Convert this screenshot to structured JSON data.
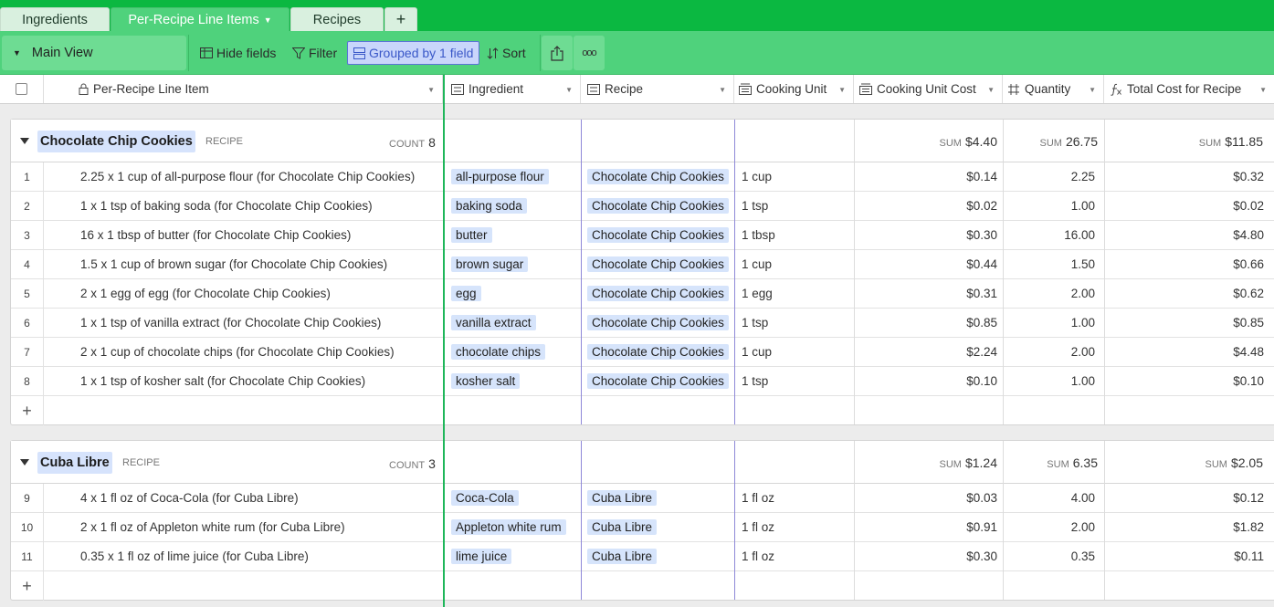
{
  "tabs": [
    {
      "label": "Ingredients"
    },
    {
      "label": "Per-Recipe Line Items"
    },
    {
      "label": "Recipes"
    },
    {
      "label": "+"
    }
  ],
  "toolbar": {
    "view_name": "Main View",
    "hide_fields": "Hide fields",
    "filter": "Filter",
    "grouped": "Grouped by 1 field",
    "sort": "Sort",
    "more": "ooo"
  },
  "columns": {
    "primary": "Per-Recipe Line Item",
    "ingredient": "Ingredient",
    "recipe": "Recipe",
    "unit": "Cooking Unit",
    "unit_cost": "Cooking Unit Cost",
    "quantity": "Quantity",
    "total": "Total Cost for Recipe"
  },
  "groups": [
    {
      "name": "Chocolate Chip Cookies",
      "field": "RECIPE",
      "count_label": "COUNT",
      "count": "8",
      "sum_label": "SUM",
      "sum_unit_cost": "$4.40",
      "sum_quantity": "26.75",
      "sum_total": "$11.85",
      "rows": [
        {
          "n": "1",
          "item": "2.25 x 1 cup of all-purpose flour (for Chocolate Chip Cookies)",
          "ingredient": "all-purpose flour",
          "recipe": "Chocolate Chip Cookies",
          "unit": "1 cup",
          "unit_cost": "$0.14",
          "qty": "2.25",
          "total": "$0.32"
        },
        {
          "n": "2",
          "item": "1 x 1 tsp of baking soda (for Chocolate Chip Cookies)",
          "ingredient": "baking soda",
          "recipe": "Chocolate Chip Cookies",
          "unit": "1 tsp",
          "unit_cost": "$0.02",
          "qty": "1.00",
          "total": "$0.02"
        },
        {
          "n": "3",
          "item": "16 x 1 tbsp of butter (for Chocolate Chip Cookies)",
          "ingredient": "butter",
          "recipe": "Chocolate Chip Cookies",
          "unit": "1 tbsp",
          "unit_cost": "$0.30",
          "qty": "16.00",
          "total": "$4.80"
        },
        {
          "n": "4",
          "item": "1.5 x 1 cup of brown sugar (for Chocolate Chip Cookies)",
          "ingredient": "brown sugar",
          "recipe": "Chocolate Chip Cookies",
          "unit": "1 cup",
          "unit_cost": "$0.44",
          "qty": "1.50",
          "total": "$0.66"
        },
        {
          "n": "5",
          "item": "2 x 1 egg of egg (for Chocolate Chip Cookies)",
          "ingredient": "egg",
          "recipe": "Chocolate Chip Cookies",
          "unit": "1 egg",
          "unit_cost": "$0.31",
          "qty": "2.00",
          "total": "$0.62"
        },
        {
          "n": "6",
          "item": "1 x 1 tsp of vanilla extract (for Chocolate Chip Cookies)",
          "ingredient": "vanilla extract",
          "recipe": "Chocolate Chip Cookies",
          "unit": "1 tsp",
          "unit_cost": "$0.85",
          "qty": "1.00",
          "total": "$0.85"
        },
        {
          "n": "7",
          "item": "2 x 1 cup of chocolate chips (for Chocolate Chip Cookies)",
          "ingredient": "chocolate chips",
          "recipe": "Chocolate Chip Cookies",
          "unit": "1 cup",
          "unit_cost": "$2.24",
          "qty": "2.00",
          "total": "$4.48"
        },
        {
          "n": "8",
          "item": "1 x 1 tsp of kosher salt (for Chocolate Chip Cookies)",
          "ingredient": "kosher salt",
          "recipe": "Chocolate Chip Cookies",
          "unit": "1 tsp",
          "unit_cost": "$0.10",
          "qty": "1.00",
          "total": "$0.10"
        }
      ]
    },
    {
      "name": "Cuba Libre",
      "field": "RECIPE",
      "count_label": "COUNT",
      "count": "3",
      "sum_label": "SUM",
      "sum_unit_cost": "$1.24",
      "sum_quantity": "6.35",
      "sum_total": "$2.05",
      "rows": [
        {
          "n": "9",
          "item": "4 x 1 fl oz of Coca-Cola (for Cuba Libre)",
          "ingredient": "Coca-Cola",
          "recipe": "Cuba Libre",
          "unit": "1 fl oz",
          "unit_cost": "$0.03",
          "qty": "4.00",
          "total": "$0.12"
        },
        {
          "n": "10",
          "item": "2 x 1 fl oz of Appleton white rum (for Cuba Libre)",
          "ingredient": "Appleton white rum",
          "recipe": "Cuba Libre",
          "unit": "1 fl oz",
          "unit_cost": "$0.91",
          "qty": "2.00",
          "total": "$1.82"
        },
        {
          "n": "11",
          "item": "0.35 x 1 fl oz of lime juice (for Cuba Libre)",
          "ingredient": "lime juice",
          "recipe": "Cuba Libre",
          "unit": "1 fl oz",
          "unit_cost": "$0.30",
          "qty": "0.35",
          "total": "$0.11"
        }
      ]
    }
  ],
  "add_row_label": "+",
  "colors": {
    "brand_green": "#0bb841",
    "toolbar_green": "#4fd27c",
    "pill_blue": "#d6e4fb",
    "group_badge": "#d6e3fc"
  }
}
